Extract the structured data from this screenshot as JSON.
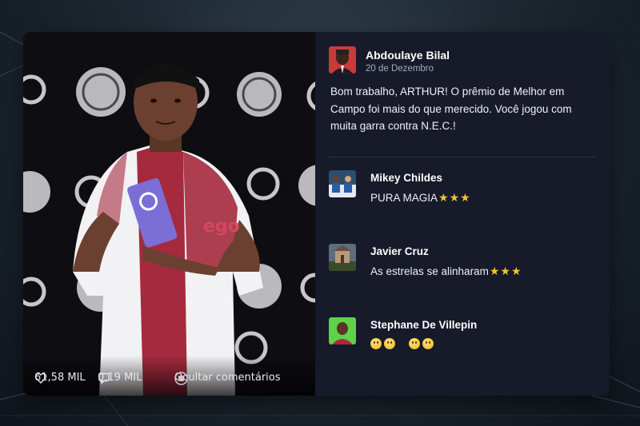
{
  "post": {
    "author": "Abdoulaye Bilal",
    "date": "20 de Dezembro",
    "text": "Bom trabalho, ARTHUR! O prêmio de Melhor em Campo foi mais do que merecido. Você jogou com muita garra contra N.E.C.!"
  },
  "stats": {
    "likes": "61,58 MIL",
    "comments": "0,19 MIL",
    "hide_comments": "Ocultar comentários"
  },
  "comments": [
    {
      "name": "Mikey Childes",
      "text": "PURA MAGIA",
      "emojis": [
        "star-emoji",
        "star-emoji",
        "star-emoji"
      ]
    },
    {
      "name": "Javier Cruz",
      "text": "As estrelas se alinharam",
      "emojis": [
        "star-emoji",
        "star-emoji",
        "star-emoji"
      ]
    },
    {
      "name": "Stephane De Villepin",
      "text": "",
      "emojis": [
        "neutral-face-emoji",
        "smiling-face-emoji",
        "grinning-face-emoji",
        "tearful-face-emoji"
      ]
    }
  ],
  "colors": {
    "panel_bg": "#161a29",
    "photo_bg": "#0c0c10",
    "jersey_red": "#a52a3e",
    "trophy_purple": "#7b6fd6",
    "star": "#f4c430"
  }
}
